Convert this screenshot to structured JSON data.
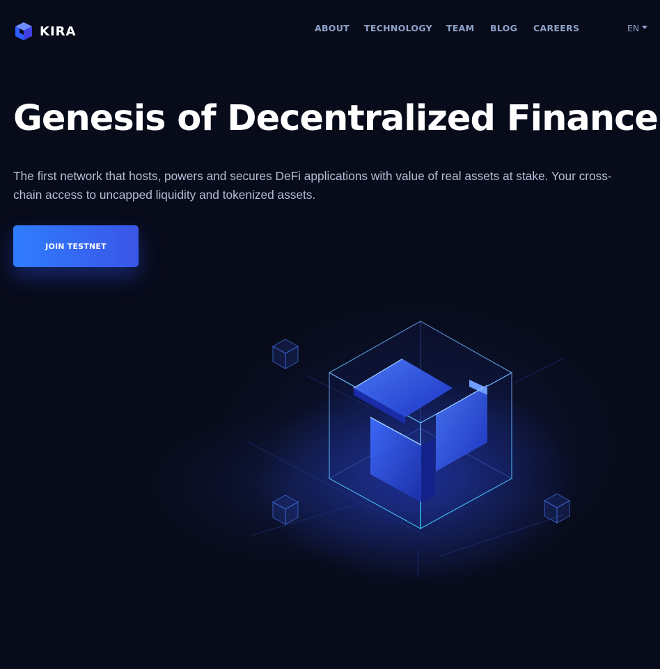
{
  "brand": {
    "name": "KIRA",
    "logo_icon": "kira-cube-logo-icon",
    "accent": "#2f7dff",
    "background": "#080b1a"
  },
  "nav": {
    "items": [
      {
        "label": "ABOUT"
      },
      {
        "label": "TECHNOLOGY"
      },
      {
        "label": "TEAM"
      },
      {
        "label": "BLOG"
      },
      {
        "label": "CAREERS"
      }
    ],
    "language": "EN",
    "language_icon": "caret-down-icon"
  },
  "hero": {
    "title": "Genesis of Decentralized Finance",
    "subtitle": "The first network that hosts, powers and secures DeFi applications with value of real assets at stake. Your cross-chain access to uncapped liquidity and tokenized assets.",
    "cta_label": "JOIN TESTNET",
    "illustration": "glowing-cube-illustration"
  }
}
